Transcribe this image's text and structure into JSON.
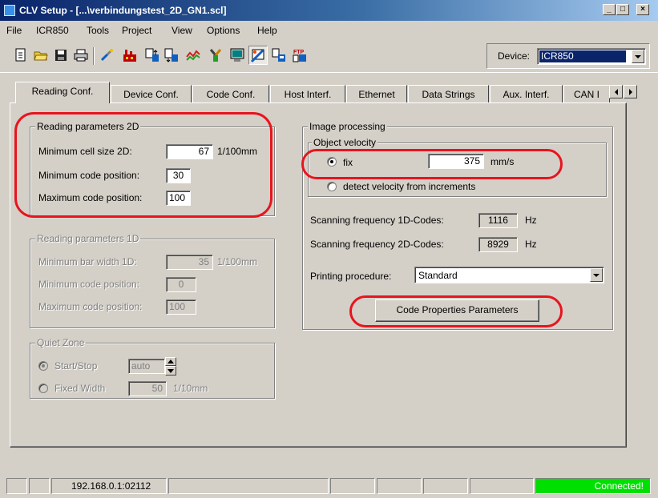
{
  "window": {
    "title": "CLV Setup - [...\\verbindungstest_2D_GN1.scl]",
    "controls": {
      "minimize": "_",
      "maximize": "□",
      "close": "×"
    }
  },
  "menu": [
    "File",
    "ICR850",
    "Tools",
    "Project",
    "View",
    "Options",
    "Help"
  ],
  "toolbar": {
    "buttons": [
      "new-file-icon",
      "open-folder-icon",
      "save-disk-icon",
      "print-icon",
      "connect-device-icon",
      "factory-icon",
      "upload-icon",
      "download-icon",
      "chart-icon",
      "tools-icon",
      "monitor-icon",
      "terminal-icon",
      "transfer-icon",
      "ftp-icon"
    ],
    "device_label": "Device:",
    "device_value": "ICR850"
  },
  "tabs": [
    "Reading Conf.",
    "Device Conf.",
    "Code Conf.",
    "Host Interf.",
    "Ethernet",
    "Data Strings",
    "Aux. Interf.",
    "CAN I"
  ],
  "active_tab": "Reading Conf.",
  "reading_2d": {
    "title": "Reading parameters 2D",
    "min_cell_label": "Minimum cell size 2D:",
    "min_cell_value": "67",
    "min_cell_unit": "1/100mm",
    "min_pos_label": "Minimum code position:",
    "min_pos_value": "30",
    "max_pos_label": "Maximum code position:",
    "max_pos_value": "100"
  },
  "reading_1d": {
    "title": "Reading parameters 1D",
    "min_bar_label": "Minimum bar width 1D:",
    "min_bar_value": "35",
    "min_bar_unit": "1/100mm",
    "min_pos_label": "Minimum code position:",
    "min_pos_value": "0",
    "max_pos_label": "Maximum code position:",
    "max_pos_value": "100"
  },
  "quiet_zone": {
    "title": "Quiet Zone",
    "start_stop_label": "Start/Stop",
    "start_stop_value": "auto",
    "fixed_label": "Fixed Width",
    "fixed_value": "50",
    "fixed_unit": "1/10mm"
  },
  "image_processing": {
    "title": "Image processing",
    "velocity_title": "Object velocity",
    "fix_label": "fix",
    "fix_value": "375",
    "fix_unit": "mm/s",
    "detect_label": "detect velocity from increments",
    "freq_1d_label": "Scanning frequency 1D-Codes:",
    "freq_1d_value": "1116",
    "freq_2d_label": "Scanning frequency 2D-Codes:",
    "freq_2d_value": "8929",
    "freq_unit": "Hz",
    "printing_label": "Printing procedure:",
    "printing_value": "Standard",
    "code_props_button": "Code Properties Parameters"
  },
  "status": {
    "address": "192.168.0.1:02112",
    "connection": "Connected!"
  },
  "colors": {
    "title_active": "#0a246a",
    "face": "#d4d0c8",
    "highlight_ring": "#e8141e",
    "connected": "#00e000"
  }
}
